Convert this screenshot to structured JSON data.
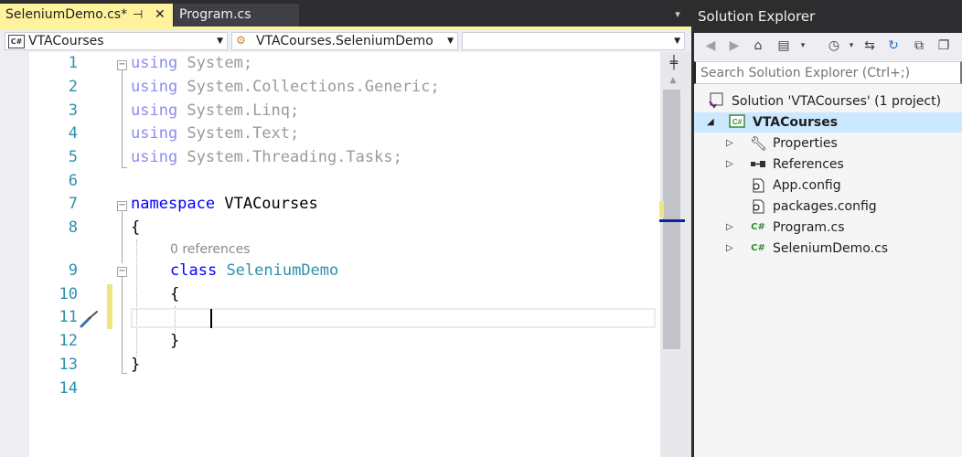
{
  "editor": {
    "tabs": [
      {
        "label": "SeleniumDemo.cs*",
        "pin_glyph": "⊣",
        "close_glyph": "✕"
      },
      {
        "label": "Program.cs"
      }
    ],
    "overflow_glyph": "▾",
    "nav": {
      "project": "VTACourses",
      "class": "VTACourses.SeleniumDemo",
      "member": ""
    },
    "line_numbers": [
      "1",
      "2",
      "3",
      "4",
      "5",
      "6",
      "7",
      "8",
      "9",
      "10",
      "11",
      "12",
      "13",
      "14"
    ],
    "code": {
      "l1_kw": "using",
      "l1_rest": " System;",
      "l2_kw": "using",
      "l2_rest": " System.Collections.Generic;",
      "l3_kw": "using",
      "l3_rest": " System.Linq;",
      "l4_kw": "using",
      "l4_rest": " System.Text;",
      "l5_kw": "using",
      "l5_rest": " System.Threading.Tasks;",
      "l7_kw": "namespace",
      "l7_rest": " VTACourses",
      "l8": "{",
      "codelens": "0 references",
      "l9_kw": "class",
      "l9_type": "SeleniumDemo",
      "l10": "{",
      "l12": "}",
      "l13": "}"
    }
  },
  "solution_explorer": {
    "title": "Solution Explorer",
    "search_placeholder": "Search Solution Explorer (Ctrl+;)",
    "solution_label": "Solution 'VTACourses' (1 project)",
    "project_label": "VTACourses",
    "items": [
      "Properties",
      "References",
      "App.config",
      "packages.config",
      "Program.cs",
      "SeleniumDemo.cs"
    ]
  },
  "colors": {
    "accent_tab": "#fff29d",
    "keyword": "#0000ff",
    "type": "#2b91af",
    "line_number": "#2b91af",
    "selection": "#cce8ff"
  }
}
